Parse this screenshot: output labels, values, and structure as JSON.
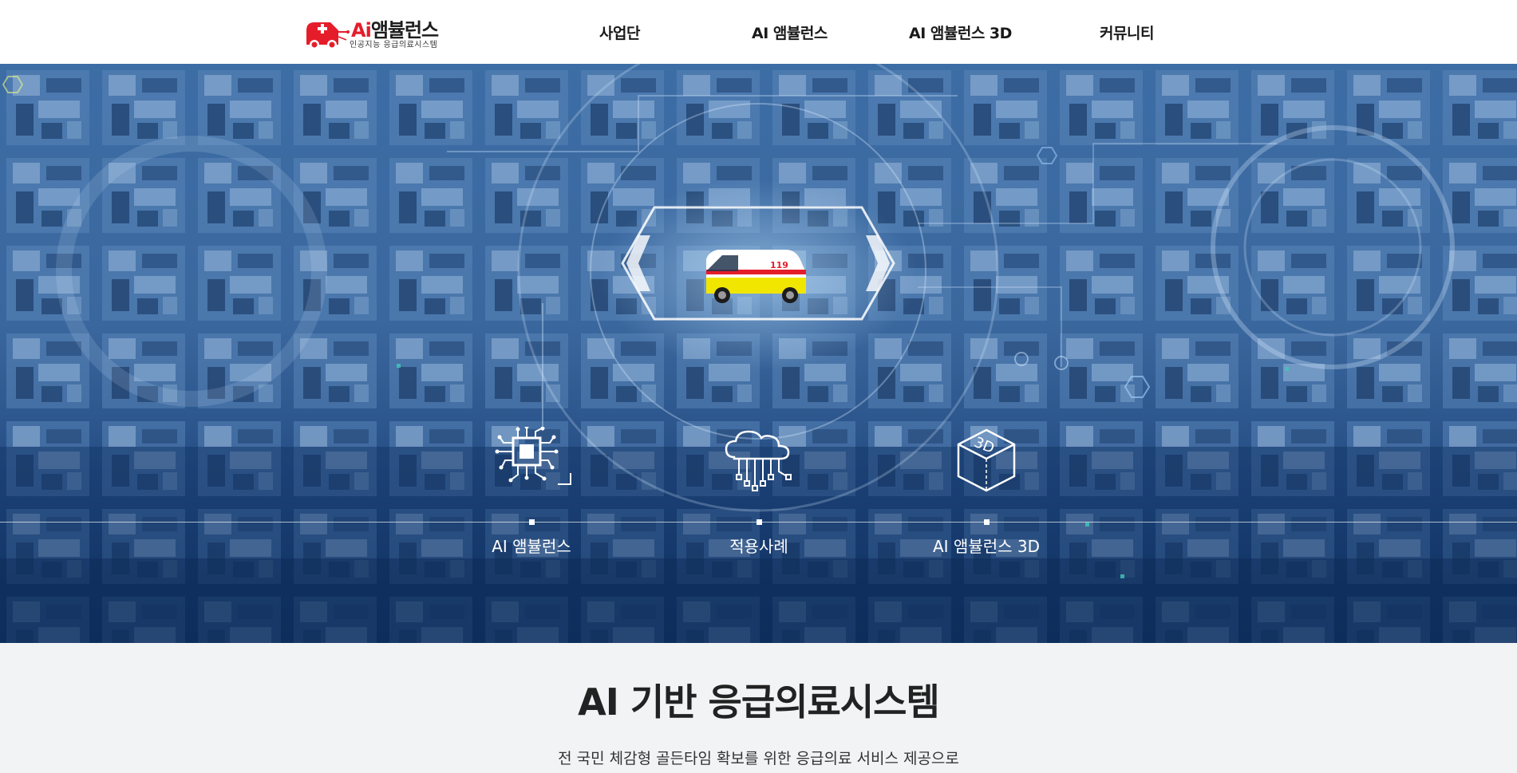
{
  "header": {
    "logo": {
      "brand_prefix": "Ai",
      "brand_name": "앰뷸런스",
      "tagline": "인공지능 응급의료시스템",
      "mark_icon": "ambulance-plus-icon"
    },
    "nav": [
      {
        "label": "사업단"
      },
      {
        "label": "AI 앰뷸런스"
      },
      {
        "label": "AI 앰뷸런스 3D"
      },
      {
        "label": "커뮤니티"
      }
    ]
  },
  "hero": {
    "center_icon": "ambulance-icon",
    "tiles": [
      {
        "label": "AI 앰뷸런스",
        "icon": "ai-chip-icon"
      },
      {
        "label": "적용사례",
        "icon": "cloud-network-icon"
      },
      {
        "label": "AI 앰뷸런스 3D",
        "icon": "cube-3d-icon",
        "icon_text": "3D"
      }
    ]
  },
  "intro": {
    "title": "AI 기반 응급의료시스템",
    "subtitle": "전 국민 체감형 골든타임 확보를 위한 응급의료 서비스 제공으로"
  },
  "colors": {
    "brand_red": "#e51d2a",
    "hero_blue": "#3a679e",
    "hero_dark": "#0f3162",
    "intro_bg": "#f1f3f4"
  }
}
